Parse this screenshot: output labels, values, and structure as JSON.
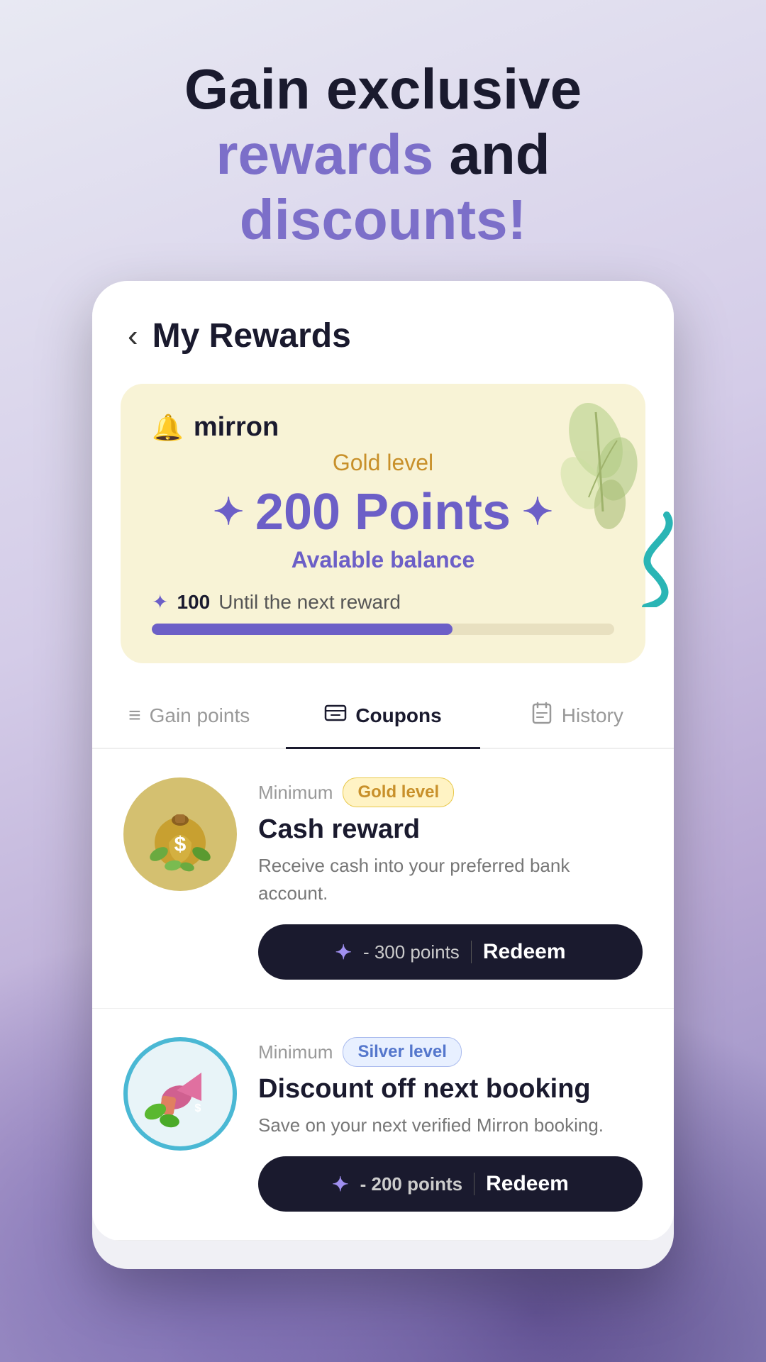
{
  "header": {
    "line1": "Gain exclusive",
    "line2_part1": "rewards",
    "line2_part2": " and",
    "line3": "discounts!"
  },
  "app": {
    "nav": {
      "back_label": "‹",
      "title": "My Rewards"
    },
    "points_card": {
      "brand_icon": "🔔",
      "brand_name": "mirron",
      "level": "Gold level",
      "points": "200 Points",
      "balance_label": "Avalable balance",
      "next_reward_prefix": "✦",
      "next_reward_number": "100",
      "next_reward_suffix": "Until the next reward",
      "progress_percent": 65
    },
    "tabs": [
      {
        "id": "gain",
        "label": "Gain points",
        "icon": "≡"
      },
      {
        "id": "coupons",
        "label": "Coupons",
        "icon": "🎫",
        "active": true
      },
      {
        "id": "history",
        "label": "History",
        "icon": "📅"
      }
    ],
    "coupons": [
      {
        "id": "cash",
        "minimum_label": "Minimum",
        "level_badge": "Gold level",
        "level_type": "gold",
        "title": "Cash reward",
        "description": "Receive cash into your preferred bank account.",
        "redeem_points": "- 300 points",
        "redeem_label": "Redeem",
        "sparkle_icon": "✦"
      },
      {
        "id": "discount",
        "minimum_label": "Minimum",
        "level_badge": "Silver level",
        "level_type": "silver",
        "title": "Discount off next booking",
        "description": "Save on your next verified Mirron booking.",
        "redeem_points": "- 200 points",
        "redeem_label": "Redeem",
        "sparkle_icon": "✦"
      }
    ]
  }
}
